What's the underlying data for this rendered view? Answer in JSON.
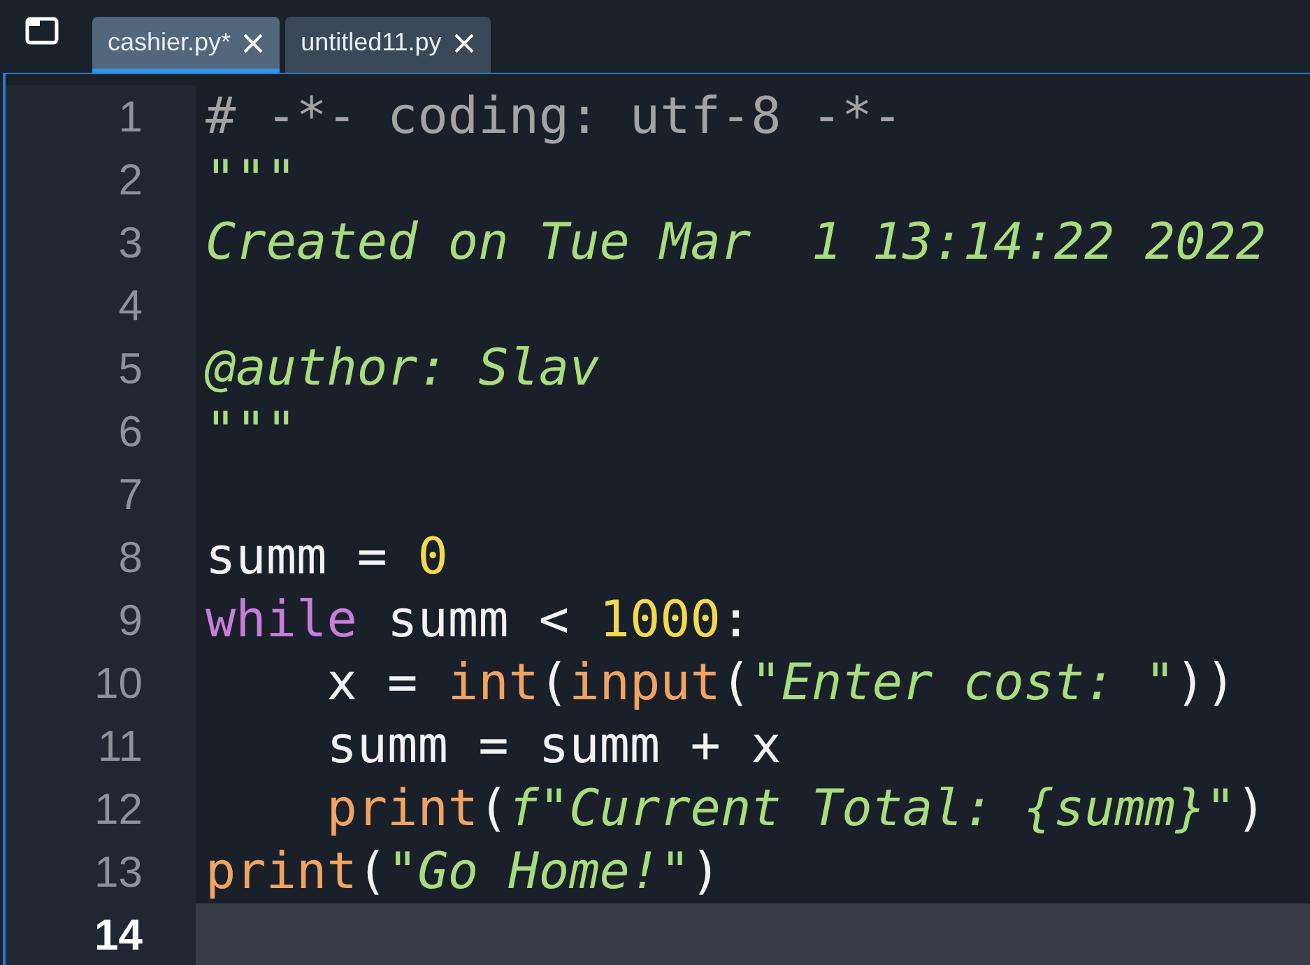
{
  "tabs": [
    {
      "label": "cashier.py*",
      "selected": true
    },
    {
      "label": "untitled11.py",
      "selected": false
    }
  ],
  "lines": [
    {
      "number": "1",
      "current": false,
      "tokens": [
        {
          "kind": "comment",
          "text": "# -*- coding: utf-8 -*-"
        }
      ]
    },
    {
      "number": "2",
      "current": false,
      "tokens": [
        {
          "kind": "docstring",
          "text": "\"\"\""
        }
      ]
    },
    {
      "number": "3",
      "current": false,
      "tokens": [
        {
          "kind": "docstring",
          "text": "Created on Tue Mar  1 13:14:22 2022"
        }
      ]
    },
    {
      "number": "4",
      "current": false
    },
    {
      "number": "5",
      "current": false,
      "tokens": [
        {
          "kind": "docstring",
          "text": "@author: Slav"
        }
      ]
    },
    {
      "number": "6",
      "current": false,
      "tokens": [
        {
          "kind": "docstring",
          "text": "\"\"\""
        }
      ]
    },
    {
      "number": "7",
      "current": false
    },
    {
      "number": "8",
      "current": false,
      "tokens": [
        {
          "kind": "plain",
          "text": "summ = "
        },
        {
          "kind": "number",
          "text": "0"
        }
      ]
    },
    {
      "number": "9",
      "current": false,
      "tokens": [
        {
          "kind": "keyword",
          "text": "while"
        },
        {
          "kind": "plain",
          "text": " summ < "
        },
        {
          "kind": "number",
          "text": "1000"
        },
        {
          "kind": "plain",
          "text": ":"
        }
      ]
    },
    {
      "number": "10",
      "current": false,
      "tokens": [
        {
          "kind": "plain",
          "text": "    x = "
        },
        {
          "kind": "builtin",
          "text": "int"
        },
        {
          "kind": "plain",
          "text": "("
        },
        {
          "kind": "builtin",
          "text": "input"
        },
        {
          "kind": "plain",
          "text": "("
        },
        {
          "kind": "string",
          "text": "\"Enter cost: \""
        },
        {
          "kind": "plain",
          "text": "))"
        }
      ]
    },
    {
      "number": "11",
      "current": false,
      "tokens": [
        {
          "kind": "plain",
          "text": "    summ = summ + x"
        }
      ]
    },
    {
      "number": "12",
      "current": false,
      "tokens": [
        {
          "kind": "builtin",
          "text": "    print"
        },
        {
          "kind": "plain",
          "text": "("
        },
        {
          "kind": "string",
          "text": "f\"Current Total: {summ}\""
        },
        {
          "kind": "plain",
          "text": ")"
        }
      ]
    },
    {
      "number": "13",
      "current": false,
      "tokens": [
        {
          "kind": "builtin",
          "text": "print"
        },
        {
          "kind": "plain",
          "text": "("
        },
        {
          "kind": "string",
          "text": "\"Go Home!\""
        },
        {
          "kind": "plain",
          "text": ")"
        }
      ]
    },
    {
      "number": "14",
      "current": true
    }
  ]
}
